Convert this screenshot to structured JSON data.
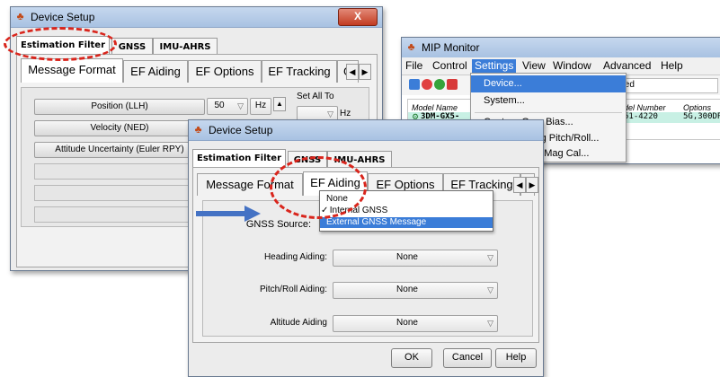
{
  "win1": {
    "title": "Device Setup",
    "close": "X",
    "tabs": [
      "Estimation Filter",
      "GNSS",
      "IMU-AHRS"
    ],
    "subtabs": [
      "Message Format",
      "EF Aiding",
      "EF Options",
      "EF Tracking",
      "G"
    ],
    "rows": [
      {
        "label": "Position (LLH)",
        "rate": "50",
        "unit": "Hz"
      },
      {
        "label": "Velocity (NED)"
      },
      {
        "label": "Attitude Uncertainty (Euler RPY)"
      }
    ],
    "set_all_label": "Set All To",
    "set_all_unit": "Hz"
  },
  "win2": {
    "title": "Device Setup",
    "tabs": [
      "Estimation Filter",
      "GNSS",
      "IMU-AHRS"
    ],
    "subtabs": [
      "Message Format",
      "EF Aiding",
      "EF Options",
      "EF Tracking",
      "G"
    ],
    "fields": [
      {
        "label": "GNSS Source:"
      },
      {
        "label": "Heading Aiding:",
        "value": "None"
      },
      {
        "label": "Pitch/Roll Aiding:",
        "value": "None"
      },
      {
        "label": "Altitude Aiding",
        "value": "None"
      }
    ],
    "gnss_options": [
      "None",
      "Internal GNSS",
      "External GNSS Message"
    ],
    "gnss_checked_mark": "✓",
    "buttons": {
      "ok": "OK",
      "cancel": "Cancel",
      "help": "Help"
    }
  },
  "mip": {
    "title": "MIP Monitor",
    "menu": [
      "File",
      "Control",
      "Settings",
      "View",
      "Window",
      "Advanced",
      "Help"
    ],
    "settings_menu": [
      "Device...",
      "System...",
      "Capture Gyro Bias...",
      "Tare Mounting Pitch/Roll...",
      "Capture Auto Mag Cal..."
    ],
    "status_fragment": "ted",
    "table": {
      "headers": [
        "Model Name",
        "del Number",
        "Options"
      ],
      "row": [
        "3DM-GX5-",
        "51-4220",
        "5G,300DP"
      ]
    }
  },
  "colors": {
    "highlight": "#3b7dd8",
    "callout_red": "#d9251c",
    "callout_blue": "#4472c4"
  }
}
